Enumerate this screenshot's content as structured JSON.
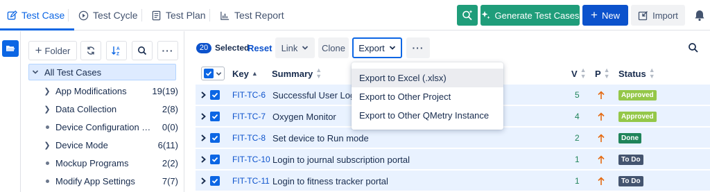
{
  "nav": {
    "tabs": [
      {
        "label": "Test Case",
        "icon": "edit-icon",
        "active": true
      },
      {
        "label": "Test Cycle",
        "icon": "play-circle-icon",
        "active": false
      },
      {
        "label": "Test Plan",
        "icon": "document-icon",
        "active": false
      },
      {
        "label": "Test Report",
        "icon": "bar-chart-icon",
        "active": false
      }
    ],
    "generate_label": "Generate Test Cases",
    "new_label": "New",
    "import_label": "Import"
  },
  "folders": {
    "folder_button_label": "Folder",
    "root_label": "All Test Cases",
    "items": [
      {
        "label": "App Modifications",
        "count": "19(19)",
        "expandable": true
      },
      {
        "label": "Data Collection",
        "count": "2(8)",
        "expandable": true
      },
      {
        "label": "Device Configuration fo...",
        "count": "0(0)",
        "expandable": false
      },
      {
        "label": "Device Mode",
        "count": "6(11)",
        "expandable": true
      },
      {
        "label": "Mockup Programs",
        "count": "2(2)",
        "expandable": false
      },
      {
        "label": "Modify App Settings",
        "count": "7(7)",
        "expandable": false
      }
    ]
  },
  "toolbar": {
    "selected_count": "20",
    "selected_label": "Selected",
    "reset_label": "Reset",
    "link_label": "Link",
    "clone_label": "Clone",
    "export_label": "Export"
  },
  "export_menu": {
    "items": [
      "Export to Excel (.xlsx)",
      "Export to Other Project",
      "Export to Other QMetry Instance"
    ]
  },
  "table": {
    "columns": {
      "key": "Key",
      "summary": "Summary",
      "version": "V",
      "priority": "P",
      "status": "Status"
    },
    "rows": [
      {
        "key": "FIT-TC-6",
        "summary": "Successful User Login",
        "version": "5",
        "status": "Approved",
        "status_color": "#94c748"
      },
      {
        "key": "FIT-TC-7",
        "summary": "Oxygen Monitor",
        "version": "4",
        "status": "Approved",
        "status_color": "#94c748"
      },
      {
        "key": "FIT-TC-8",
        "summary": "Set device to Run mode",
        "version": "2",
        "status": "Done",
        "status_color": "#1f845a"
      },
      {
        "key": "FIT-TC-10",
        "summary": "Login to journal subscription portal",
        "version": "1",
        "status": "To Do",
        "status_color": "#44546f"
      },
      {
        "key": "FIT-TC-11",
        "summary": "Login to fitness tracker portal",
        "version": "1",
        "status": "To Do",
        "status_color": "#44546f"
      }
    ]
  },
  "colors": {
    "accent": "#0c66e4",
    "primary_button": "#0c52cc",
    "ai_button": "#1f9d7a",
    "priority_arrow": "#e56910",
    "row_selected": "#e9f2ff"
  }
}
